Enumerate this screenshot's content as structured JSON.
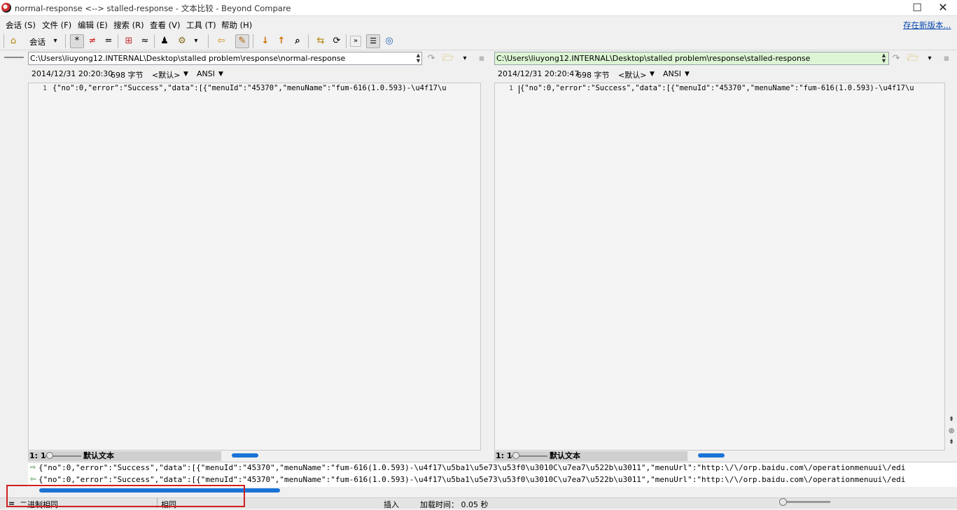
{
  "window": {
    "title": "normal-response <--> stalled-response - 文本比较 - Beyond Compare",
    "maximize_glyph": "☐",
    "close_glyph": "✕"
  },
  "menu": {
    "items": [
      "会话 (S)",
      "文件 (F)",
      "编辑 (E)",
      "搜索 (R)",
      "查看 (V)",
      "工具 (T)",
      "帮助 (H)"
    ],
    "update_link": "存在新版本..."
  },
  "toolbar": {
    "session_label": "会话",
    "buttons": [
      {
        "icon": "home-session-icon",
        "glyph": "⌂"
      },
      {
        "icon": "dropdown-arrow-icon",
        "glyph": "▾"
      },
      {
        "icon": "show-all-icon",
        "glyph": "*"
      },
      {
        "icon": "show-diffs-icon",
        "glyph": "≠"
      },
      {
        "icon": "show-same-icon",
        "glyph": "="
      },
      {
        "icon": "context-icon",
        "glyph": "⊞"
      },
      {
        "icon": "minor-icon",
        "glyph": "≈"
      },
      {
        "icon": "rules-icon",
        "glyph": "♟"
      },
      {
        "icon": "format-icon",
        "glyph": "⚙"
      },
      {
        "icon": "dropdown-arrow-icon",
        "glyph": "▾"
      },
      {
        "icon": "copy-to-left-icon",
        "glyph": "⇦"
      },
      {
        "icon": "edit-icon",
        "glyph": "✎"
      },
      {
        "icon": "next-diff-icon",
        "glyph": "↓"
      },
      {
        "icon": "prev-diff-icon",
        "glyph": "↑"
      },
      {
        "icon": "find-icon",
        "glyph": "⌕"
      },
      {
        "icon": "swap-icon",
        "glyph": "⇆"
      },
      {
        "icon": "refresh-icon",
        "glyph": "⟳"
      },
      {
        "icon": "expand-icon",
        "glyph": "»"
      },
      {
        "icon": "alignment-icon",
        "glyph": "☰"
      },
      {
        "icon": "web-icon",
        "glyph": "◎"
      }
    ]
  },
  "left": {
    "path": "C:\\Users\\liuyong12.INTERNAL\\Desktop\\stalled problem\\response\\normal-response",
    "timestamp": "2014/12/31 20:20:30",
    "size": "698 字节",
    "format": "<默认>",
    "encoding": "ANSI",
    "line_number": "1",
    "line_text": "{\"no\":0,\"error\":\"Success\",\"data\":[{\"menuId\":\"45370\",\"menuName\":\"fum-616(1.0.593)-\\u4f17\\u",
    "cursor_pos": "1: 1",
    "text_format": "默认文本"
  },
  "right": {
    "path": "C:\\Users\\liuyong12.INTERNAL\\Desktop\\stalled problem\\response\\stalled-response",
    "timestamp": "2014/12/31 20:20:47",
    "size": "698 字节",
    "format": "<默认>",
    "encoding": "ANSI",
    "line_number": "1",
    "line_text": "{\"no\":0,\"error\":\"Success\",\"data\":[{\"menuId\":\"45370\",\"menuName\":\"fum-616(1.0.593)-\\u4f17\\u",
    "cursor_pos": "1: 1",
    "text_format": "默认文本"
  },
  "compare": {
    "row1": "{\"no\":0,\"error\":\"Success\",\"data\":[{\"menuId\":\"45370\",\"menuName\":\"fum-616(1.0.593)-\\u4f17\\u5ba1\\u5e73\\u53f0\\u3010C\\u7ea7\\u522b\\u3011\",\"menuUrl\":\"http:\\/\\/orp.baidu.com\\/operationmenuui\\/edi",
    "row2": "{\"no\":0,\"error\":\"Success\",\"data\":[{\"menuId\":\"45370\",\"menuName\":\"fum-616(1.0.593)-\\u4f17\\u5ba1\\u5e73\\u53f0\\u3010C\\u7ea7\\u522b\\u3011\",\"menuUrl\":\"http:\\/\\/orp.baidu.com\\/operationmenuui\\/edi"
  },
  "statusbar": {
    "equal_glyph": "=",
    "binary_status": "二进制相同",
    "same_status": "相同",
    "mode": "插入",
    "load_time": "加载时间： 0.05 秒"
  },
  "colors": {
    "right_path_bg": "#ddf5d5",
    "scroll_thumb": "#1a73d6",
    "highlight_border": "#d02020",
    "link": "#0645ad"
  }
}
